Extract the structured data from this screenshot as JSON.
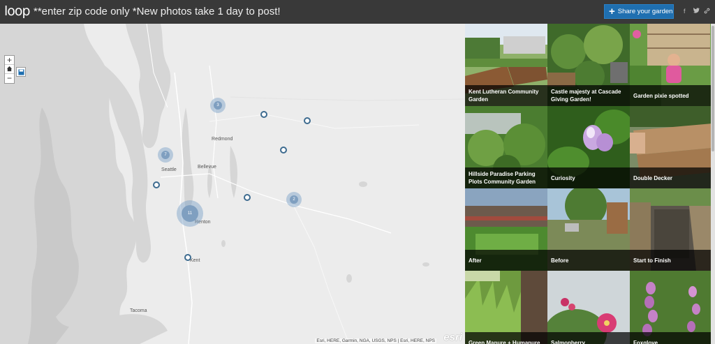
{
  "header": {
    "logo": "loop",
    "notice": "**enter zip code only *New photos take 1 day to post!",
    "share_label": "Share your garden",
    "social": [
      "f",
      "t",
      "link"
    ]
  },
  "map": {
    "cities": [
      "Redmond",
      "Seattle",
      "Bellevue",
      "Renton",
      "Kent",
      "Tacoma"
    ],
    "clusters": [
      "3",
      "7",
      "11",
      "2"
    ],
    "zoom_in": "+",
    "zoom_out": "−",
    "attribution": "Esri, HERE, Garmin, NGA, USGS, NPS | Esri, HERE, NPS",
    "esri": "esri"
  },
  "gallery": {
    "tiles": [
      {
        "caption": "Kent Lutheran Community Garden",
        "icon": "garden-beds-photo"
      },
      {
        "caption": "Castle majesty at Cascade Giving Garden!",
        "icon": "vegetable-garden-photo"
      },
      {
        "caption": "Garden pixie spotted",
        "icon": "child-in-garden-photo"
      },
      {
        "caption": "Hillside Paradise Parking Plots Community Garden",
        "icon": "greenhouse-plants-photo"
      },
      {
        "caption": "Curiosity",
        "icon": "purple-flower-photo"
      },
      {
        "caption": "Double Decker",
        "icon": "raised-bed-photo"
      },
      {
        "caption": "After",
        "icon": "backyard-after-photo"
      },
      {
        "caption": "Before",
        "icon": "backyard-before-photo"
      },
      {
        "caption": "Start to Finish",
        "icon": "mulch-bed-photo"
      },
      {
        "caption": "Green Manure + Humanure",
        "icon": "grass-cover-photo"
      },
      {
        "caption": "Salmonberry",
        "icon": "pink-blossom-photo"
      },
      {
        "caption": "Foxglove",
        "icon": "foxglove-photo"
      }
    ]
  },
  "colors": {
    "header_bg": "#393939",
    "share_button": "#1f6fb0",
    "map_land": "#ececec",
    "map_water": "#d6d6d6",
    "marker": "#3d6b8f"
  }
}
